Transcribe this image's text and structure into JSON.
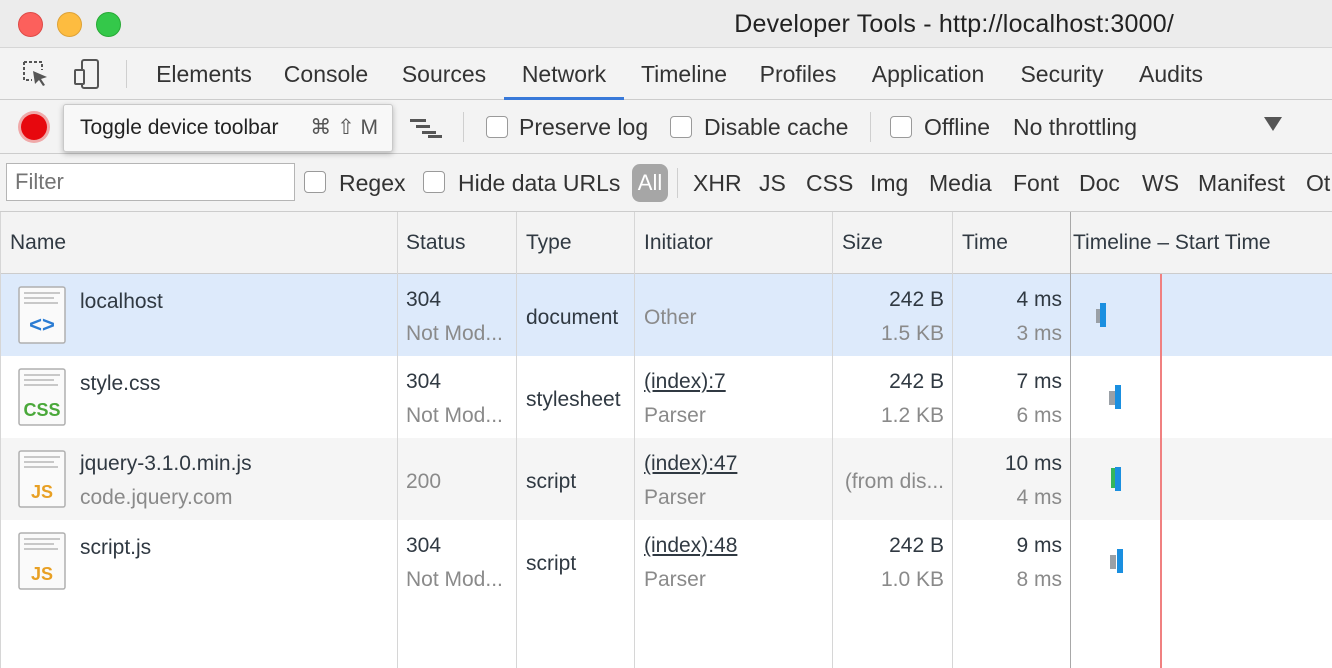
{
  "window": {
    "title": "Developer Tools - http://localhost:3000/"
  },
  "tabs": [
    {
      "label": "Elements"
    },
    {
      "label": "Console"
    },
    {
      "label": "Sources"
    },
    {
      "label": "Network",
      "active": true
    },
    {
      "label": "Timeline"
    },
    {
      "label": "Profiles"
    },
    {
      "label": "Application"
    },
    {
      "label": "Security"
    },
    {
      "label": "Audits"
    }
  ],
  "toolbar": {
    "tooltip_label": "Toggle device toolbar",
    "tooltip_shortcut": "⌘ ⇧ M",
    "preserve_log": "Preserve log",
    "disable_cache": "Disable cache",
    "offline": "Offline",
    "throttling": "No throttling"
  },
  "filter": {
    "placeholder": "Filter",
    "regex": "Regex",
    "hide_data_urls": "Hide data URLs",
    "types": [
      "All",
      "XHR",
      "JS",
      "CSS",
      "Img",
      "Media",
      "Font",
      "Doc",
      "WS",
      "Manifest",
      "Ot"
    ]
  },
  "columns": {
    "name": "Name",
    "status": "Status",
    "type": "Type",
    "initiator": "Initiator",
    "size": "Size",
    "time": "Time",
    "timeline": "Timeline – Start Time"
  },
  "rows": [
    {
      "name": "localhost",
      "subtitle": "",
      "icon": "html-file-icon",
      "icon_text": "<>",
      "status": "304",
      "status_text": "Not Mod...",
      "type": "document",
      "initiator": "Other",
      "initiator_sub": "",
      "size": "242 B",
      "size_sub": "1.5 KB",
      "time": "4 ms",
      "time_sub": "3 ms"
    },
    {
      "name": "style.css",
      "subtitle": "",
      "icon": "css-file-icon",
      "icon_text": "CSS",
      "status": "304",
      "status_text": "Not Mod...",
      "type": "stylesheet",
      "initiator": "(index):7",
      "initiator_sub": "Parser",
      "size": "242 B",
      "size_sub": "1.2 KB",
      "time": "7 ms",
      "time_sub": "6 ms"
    },
    {
      "name": "jquery-3.1.0.min.js",
      "subtitle": "code.jquery.com",
      "icon": "js-file-icon",
      "icon_text": "JS",
      "status": "200",
      "status_text": "",
      "type": "script",
      "initiator": "(index):47",
      "initiator_sub": "Parser",
      "size": "(from dis...",
      "size_sub": "",
      "time": "10 ms",
      "time_sub": "4 ms"
    },
    {
      "name": "script.js",
      "subtitle": "",
      "icon": "js-file-icon",
      "icon_text": "JS",
      "status": "304",
      "status_text": "Not Mod...",
      "type": "script",
      "initiator": "(index):48",
      "initiator_sub": "Parser",
      "size": "242 B",
      "size_sub": "1.0 KB",
      "time": "9 ms",
      "time_sub": "8 ms"
    }
  ],
  "colors": {
    "record": "#e7080e",
    "active_tab_underline": "#3879d9",
    "selected_row": "#ddeafb",
    "waterfall_blue": "#1a8fe0",
    "load_line": "#f08080"
  }
}
